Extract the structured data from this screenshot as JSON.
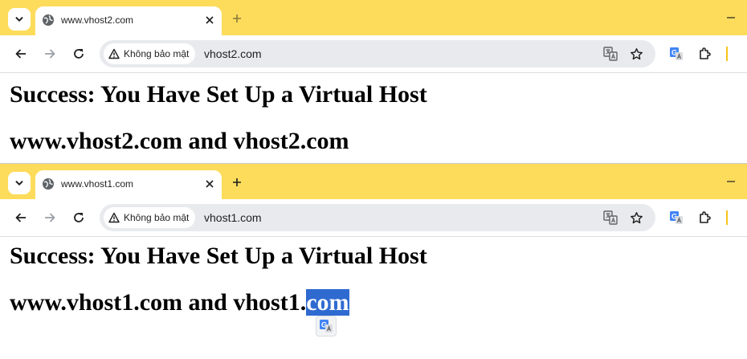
{
  "windows": [
    {
      "tab_title": "www.vhost2.com",
      "security_label": "Không bảo mật",
      "url": "vhost2.com",
      "heading": "Success: You Have Set Up a Virtual Host",
      "line": "www.vhost2.com and vhost2.com"
    },
    {
      "tab_title": "www.vhost1.com",
      "security_label": "Không bảo mật",
      "url": "vhost1.com",
      "heading": "Success: You Have Set Up a Virtual Host",
      "line_prefix": "www.vhost1.com and vhost1.",
      "line_selected": "com"
    }
  ],
  "icons": [
    "tab-search-icon",
    "globe-icon",
    "close-icon",
    "plus-icon",
    "minimize-icon",
    "back-arrow-icon",
    "forward-arrow-icon",
    "reload-icon",
    "warning-icon",
    "translate-icon",
    "star-icon",
    "google-translate-icon",
    "extensions-icon"
  ],
  "colors": {
    "tab_strip": "#fddc5c",
    "omnibox": "#e8eaed",
    "selection": "#2f6ad0"
  }
}
